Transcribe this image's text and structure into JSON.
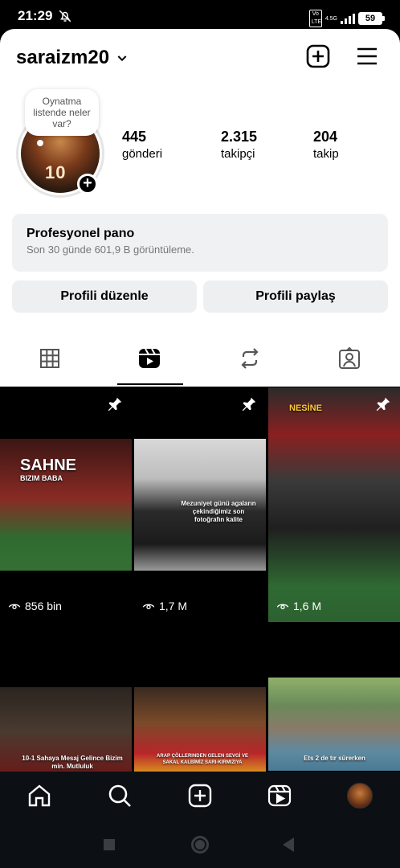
{
  "status": {
    "time": "21:29",
    "volte": "Vo LTE",
    "network": "4.5G",
    "battery": "59"
  },
  "profile": {
    "username": "saraizm20",
    "note": "Oynatma listende neler var?",
    "stats": [
      {
        "value": "445",
        "label": "gönderi"
      },
      {
        "value": "2.315",
        "label": "takipçi"
      },
      {
        "value": "204",
        "label": "takip"
      }
    ]
  },
  "pro_dashboard": {
    "title": "Profesyonel pano",
    "subtitle": "Son 30 günde 601,9 B görüntüleme."
  },
  "buttons": {
    "edit": "Profili düzenle",
    "share": "Profili paylaş"
  },
  "tabs": [
    "grid-icon",
    "reels-icon",
    "reposts-icon",
    "tagged-icon"
  ],
  "active_tab": "reels",
  "reels": [
    {
      "views": "856 bin",
      "pinned": true,
      "caption": "SAHNE",
      "sub": "BIZIM BABA"
    },
    {
      "views": "1,7 M",
      "pinned": true,
      "caption": "Mezuniyet günü agaların çekindiğimiz son fotoğrafın kalite"
    },
    {
      "views": "1,6 M",
      "pinned": true,
      "caption": "NESİNE"
    },
    {
      "caption": "10-1 Sahaya Mesaj Gelince Bizim min. Mutluluk"
    },
    {
      "caption": "ARAP ÇÖLLERINDEN GELEN SEVGİ VE SAKAL KALBİMİZ SARI-KIRMIZIYA"
    },
    {
      "caption": "Ets 2 de tır sürerken"
    }
  ],
  "colors": {
    "background": "#ffffff",
    "card": "#f0f1f3",
    "navbar": "#0c0f14"
  }
}
